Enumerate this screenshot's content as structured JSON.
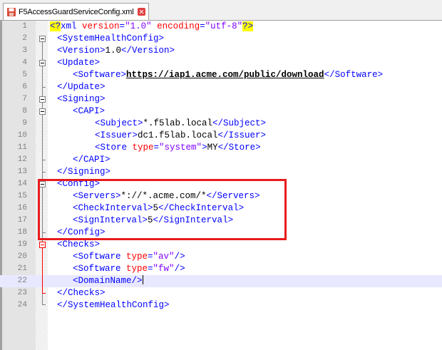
{
  "tab": {
    "title": "F5AccessGuardServiceConfig.xml",
    "file_icon": "floppy-disk-icon",
    "close_icon": "close-icon"
  },
  "colors": {
    "tag": "#0000ff",
    "attr": "#ff0000",
    "value": "#8000ff",
    "text": "#000000",
    "highlight": "#e81c1c",
    "current_line": "#e8e8ff"
  },
  "lines": [
    {
      "num": "1",
      "xml_decl": "<?",
      "tag": "xml ",
      "attr1": "version",
      "eq1": "=",
      "val1": "\"1.0\"",
      "attr2": " encoding",
      "eq2": "=",
      "val2": "\"utf-8\"",
      "pi_end": "?>"
    },
    {
      "num": "2",
      "text": "<SystemHealthConfig>"
    },
    {
      "num": "3",
      "open": "<Version>",
      "value": "1.0",
      "close": "</Version>"
    },
    {
      "num": "4",
      "text": "<Update>"
    },
    {
      "num": "5",
      "open": "<Software>",
      "value": "https://iap1.acme.com/public/download",
      "close": "</Software>"
    },
    {
      "num": "6",
      "text": "</Update>"
    },
    {
      "num": "7",
      "text": "<Signing>"
    },
    {
      "num": "8",
      "text": "<CAPI>"
    },
    {
      "num": "9",
      "open": "<Subject>",
      "value": "*.f5lab.local",
      "close": "</Subject>"
    },
    {
      "num": "10",
      "open": "<Issuer>",
      "value": "dc1.f5lab.local",
      "close": "</Issuer>"
    },
    {
      "num": "11",
      "open": "<Store ",
      "attr": "type",
      "eq": "=",
      "attrval": "\"system\"",
      "gt": ">",
      "value": "MY",
      "close": "</Store>"
    },
    {
      "num": "12",
      "text": "</CAPI>"
    },
    {
      "num": "13",
      "text": "</Signing>"
    },
    {
      "num": "14",
      "text": "<Config>"
    },
    {
      "num": "15",
      "open": "<Servers>",
      "value": "*://*.acme.com/*",
      "close": "</Servers>"
    },
    {
      "num": "16",
      "open": "<CheckInterval>",
      "value": "5",
      "close": "</CheckInterval>"
    },
    {
      "num": "17",
      "open": "<SignInterval>",
      "value": "5",
      "close": "</SignInterval>"
    },
    {
      "num": "18",
      "text": "</Config>"
    },
    {
      "num": "19",
      "text": "<Checks>"
    },
    {
      "num": "20",
      "open": "<Software ",
      "attr": "type",
      "eq": "=",
      "attrval": "\"av\"",
      "close": "/>"
    },
    {
      "num": "21",
      "open": "<Software ",
      "attr": "type",
      "eq": "=",
      "attrval": "\"fw\"",
      "close": "/>"
    },
    {
      "num": "22",
      "text": "<DomainName/>"
    },
    {
      "num": "23",
      "text": "</Checks>"
    },
    {
      "num": "24",
      "text": "</SystemHealthConfig>"
    }
  ]
}
